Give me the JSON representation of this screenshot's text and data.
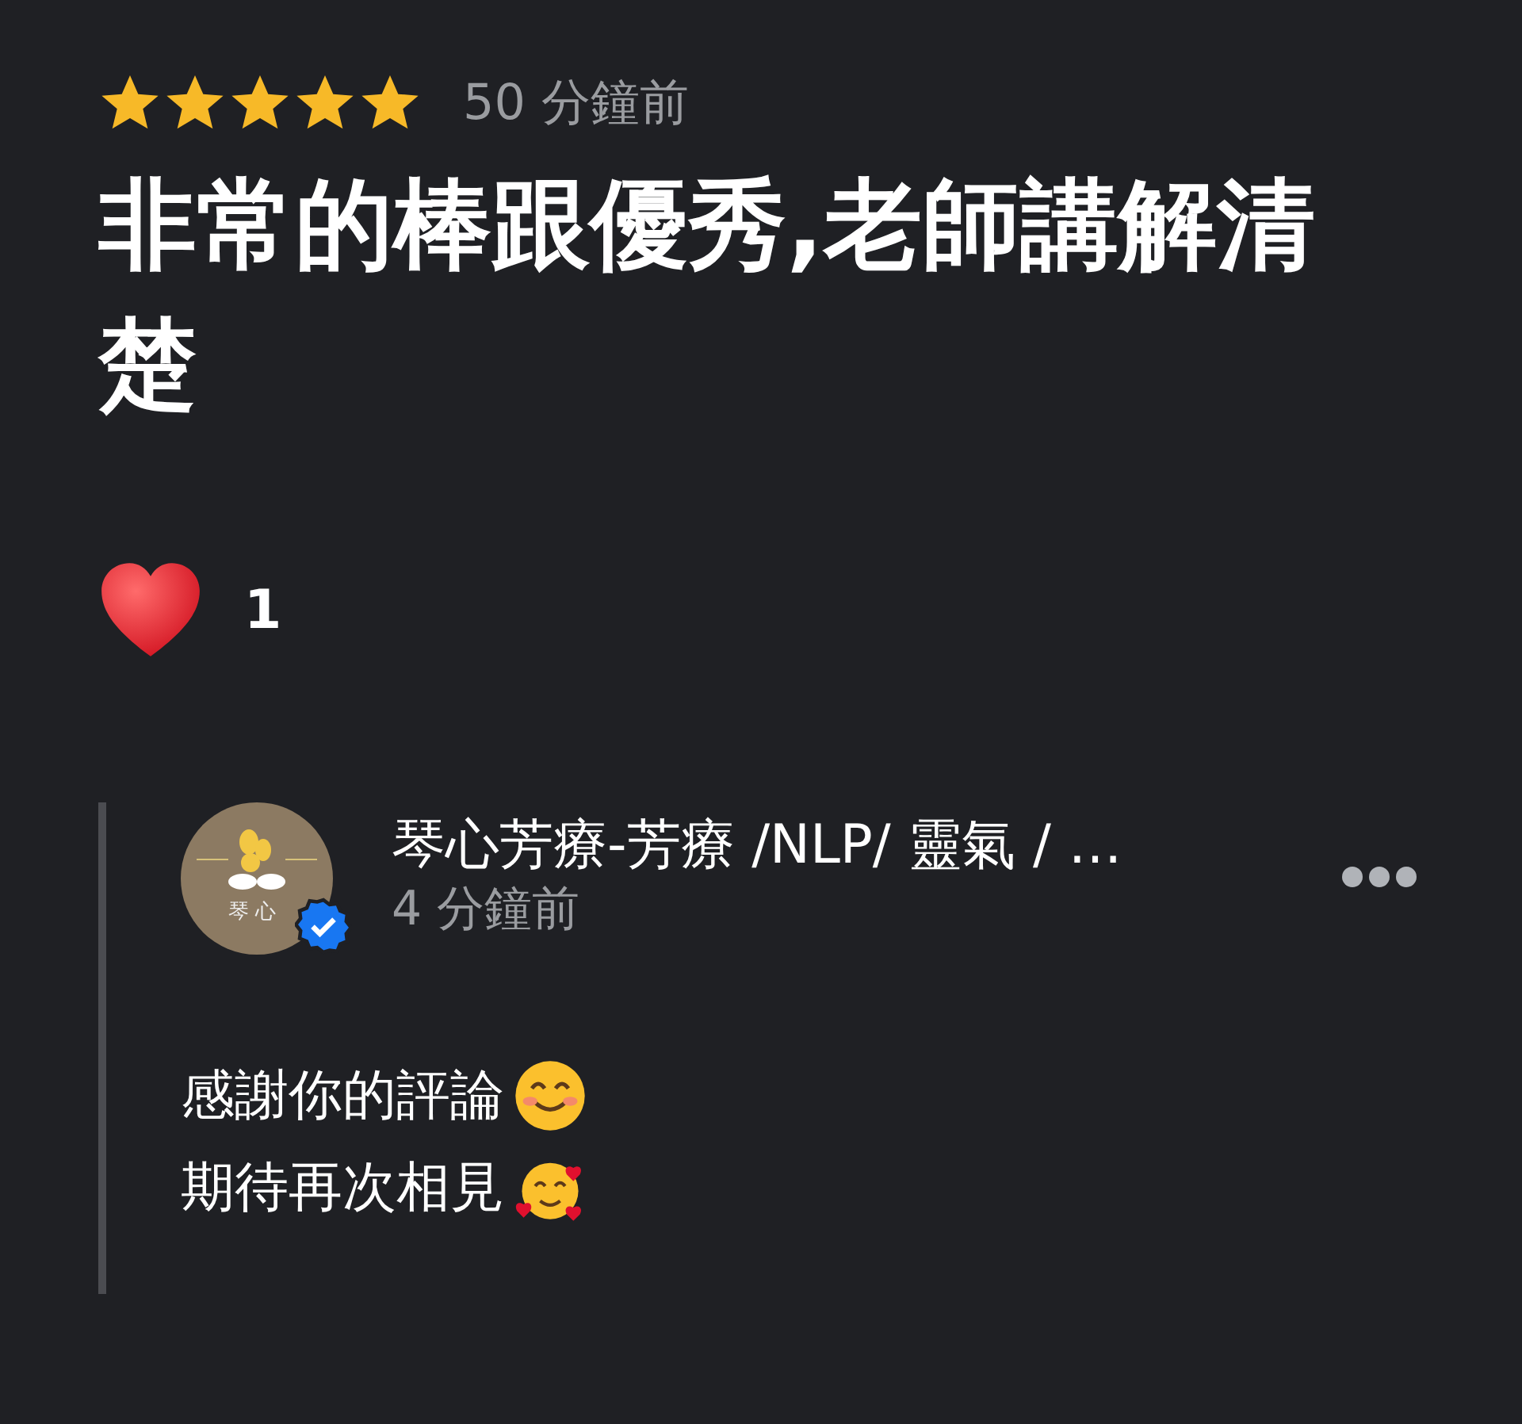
{
  "review": {
    "stars": 5,
    "time": "50 分鐘前",
    "text": "非常的棒跟優秀,老師講解清楚",
    "reactions": {
      "count": "1"
    }
  },
  "reply": {
    "author": "琴心芳療-芳療 /NLP/ 靈氣 / …",
    "verified": true,
    "avatar_text": "琴 心",
    "time": "4 分鐘前",
    "lines": [
      {
        "text": "感謝你的評論",
        "kind": "smile"
      },
      {
        "text": "期待再次相見",
        "kind": "hearts"
      }
    ]
  }
}
